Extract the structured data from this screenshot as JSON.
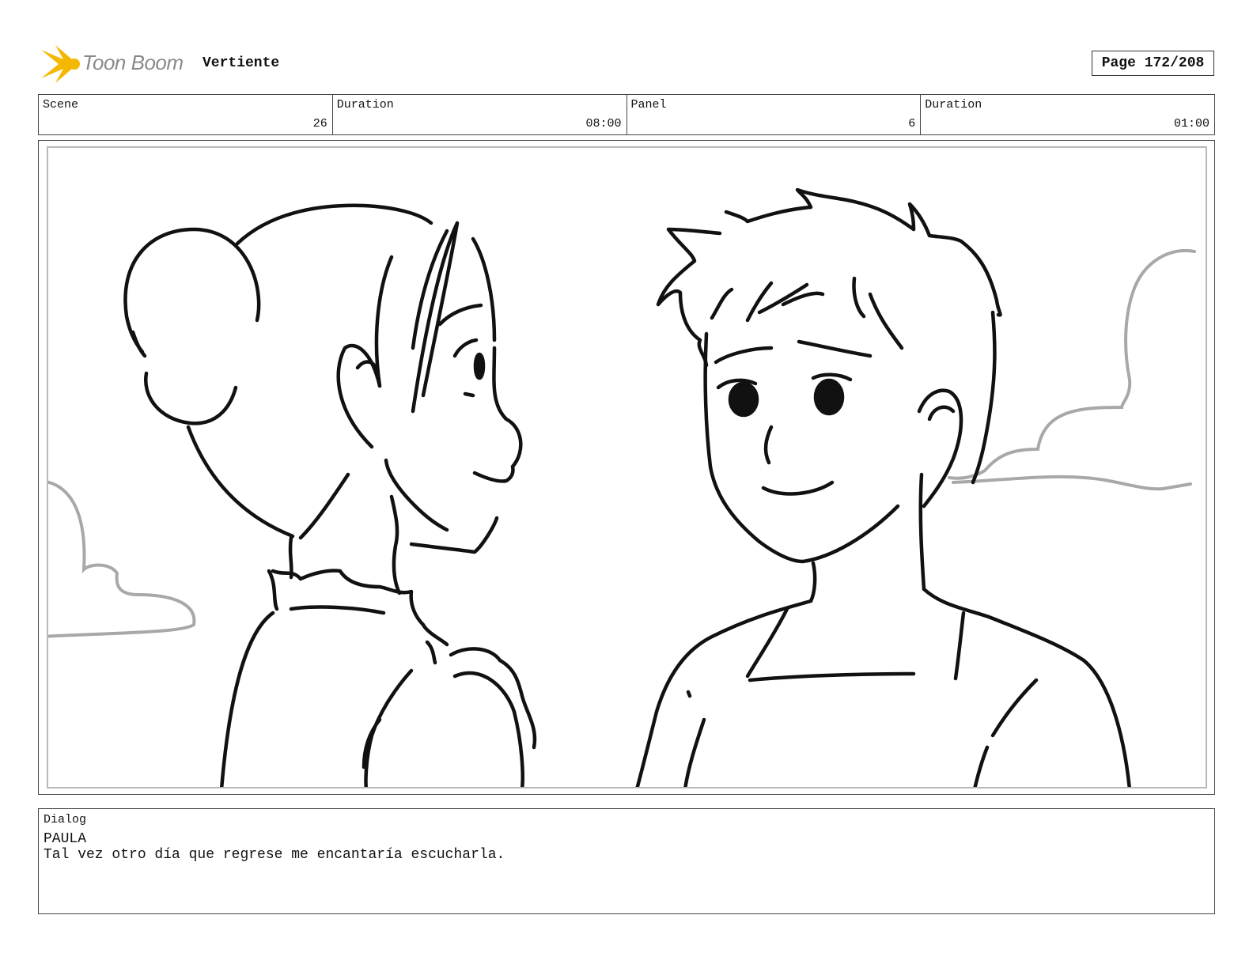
{
  "header": {
    "logo_text": "Toon Boom",
    "project_title": "Vertiente",
    "page": "Page 172/208"
  },
  "info": {
    "scene_label": "Scene",
    "scene_value": "26",
    "scene_duration_label": "Duration",
    "scene_duration_value": "08:00",
    "panel_label": "Panel",
    "panel_value": "6",
    "panel_duration_label": "Duration",
    "panel_duration_value": "01:00"
  },
  "dialog": {
    "label": "Dialog",
    "character": "PAULA",
    "line": "Tal vez otro día que regrese me encantaría escucharla."
  },
  "colors": {
    "logo_yellow": "#f5b800",
    "sketch_line": "#111111",
    "cloud_line": "#a8a8a8"
  }
}
